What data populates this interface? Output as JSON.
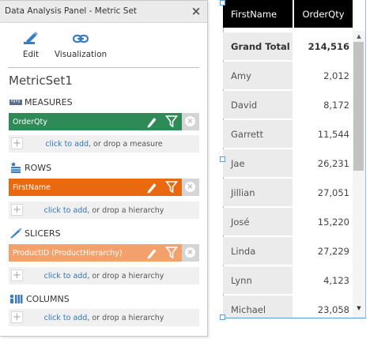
{
  "panel": {
    "title": "Data Analysis Panel - Metric Set",
    "close_glyph": "×",
    "toolbar": {
      "edit_label": "Edit",
      "edit_icon": "pencil-icon",
      "visualization_label": "Visualization",
      "visualization_icon": "link-icon"
    },
    "metric_set_name": "MetricSet1",
    "sections": {
      "measures": {
        "label": "MEASURES",
        "icon": "ruler-icon",
        "chip_label": "OrderQty",
        "chip_color": "#2e8b57",
        "dropzone_link": "click to add",
        "dropzone_rest": ", or drop a measure"
      },
      "rows": {
        "label": "ROWS",
        "icon": "rows-icon",
        "chip_label": "FirstName",
        "chip_color": "#e8690f",
        "dropzone_link": "click to add",
        "dropzone_rest": ", or drop a hierarchy"
      },
      "slicers": {
        "label": "SLICERS",
        "icon": "slicer-icon",
        "chip_label": "ProductID (ProductHierarchy)",
        "chip_color": "#f4a06a",
        "dropzone_link": "click to add",
        "dropzone_rest": ", or drop a hierarchy"
      },
      "columns": {
        "label": "COLUMNS",
        "icon": "columns-icon",
        "dropzone_link": "click to add",
        "dropzone_rest": ", or drop a hierarchy"
      }
    },
    "plus_glyph": "+",
    "remove_glyph": "×"
  },
  "grid": {
    "columns": [
      "FirstName",
      "OrderQty"
    ],
    "grand_total": {
      "label": "Grand Total",
      "value": "214,516"
    },
    "rows": [
      {
        "name": "Amy",
        "value": "2,012"
      },
      {
        "name": "David",
        "value": "8,172"
      },
      {
        "name": "Garrett",
        "value": "11,544"
      },
      {
        "name": "Jae",
        "value": "26,231"
      },
      {
        "name": "Jillian",
        "value": "27,051"
      },
      {
        "name": "José",
        "value": "15,220"
      },
      {
        "name": "Linda",
        "value": "27,229"
      },
      {
        "name": "Lynn",
        "value": "4,123"
      },
      {
        "name": "Michael",
        "value": "23,058"
      }
    ],
    "scroll_up_glyph": "▲",
    "scroll_down_glyph": "▼"
  }
}
